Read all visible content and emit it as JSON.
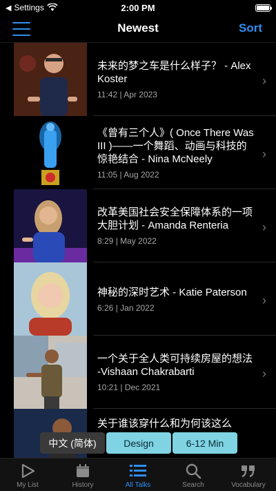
{
  "status_bar": {
    "carrier": "Settings",
    "time": "2:00 PM"
  },
  "nav": {
    "title": "Newest",
    "sort_label": "Sort"
  },
  "talks": [
    {
      "title": "未来的梦之车是什么样子？ - Alex Koster",
      "meta": "11:42 | Apr 2023"
    },
    {
      "title": "《曾有三个人》( Once There Was III )——一个舞蹈、动画与科技的惊艳结合 - Nina McNeely",
      "meta": "11:05 | Aug 2022"
    },
    {
      "title": "改革美国社会安全保障体系的一项大胆计划 - Amanda Renteria",
      "meta": "8:29 | May 2022"
    },
    {
      "title": "神秘的深时艺术 - Katie Paterson",
      "meta": "6:26 | Jan 2022"
    },
    {
      "title": "一个关于全人类可持续房屋的想法 -Vishaan Chakrabarti",
      "meta": "10:21 | Dec 2021"
    },
    {
      "title": "关于谁该穿什么和为何该这么",
      "meta": ""
    }
  ],
  "filters": {
    "language": "中文 (简体)",
    "topic": "Design",
    "duration": "6-12 Min"
  },
  "tabs": [
    {
      "label": "My List",
      "icon": "play-triangle-icon"
    },
    {
      "label": "History",
      "icon": "calendar-icon"
    },
    {
      "label": "All Talks",
      "icon": "list-icon"
    },
    {
      "label": "Search",
      "icon": "search-icon"
    },
    {
      "label": "Vocabulary",
      "icon": "quote-icon"
    }
  ],
  "colors": {
    "accent": "#2f8ff0",
    "chip": "#7fd3e2"
  }
}
